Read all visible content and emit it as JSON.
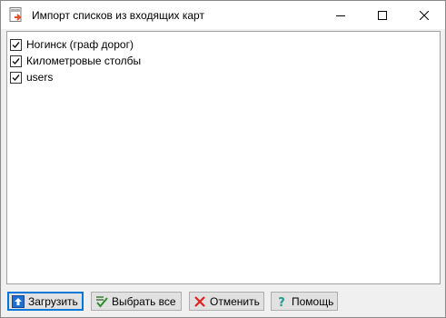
{
  "window": {
    "title": "Импорт списков из входящих карт",
    "app_icon": "document-import-icon"
  },
  "title_buttons": {
    "minimize": "minimize-icon",
    "maximize": "maximize-icon",
    "close": "close-icon"
  },
  "list": {
    "items": [
      {
        "label": "Ногинск (граф дорог)",
        "checked": true
      },
      {
        "label": "Километровые столбы",
        "checked": true
      },
      {
        "label": "users",
        "checked": true
      }
    ]
  },
  "buttons": {
    "load": {
      "label": "Загрузить",
      "icon": "upload-icon"
    },
    "select_all": {
      "label": "Выбрать все",
      "icon": "check-all-icon"
    },
    "cancel": {
      "label": "Отменить",
      "icon": "red-x-icon"
    },
    "help": {
      "label": "Помощь",
      "icon": "question-icon"
    }
  },
  "colors": {
    "accent": "#0078d7",
    "cancel_red": "#e02020",
    "help_teal": "#1a9e8f",
    "load_blue": "#1e6fd0"
  }
}
